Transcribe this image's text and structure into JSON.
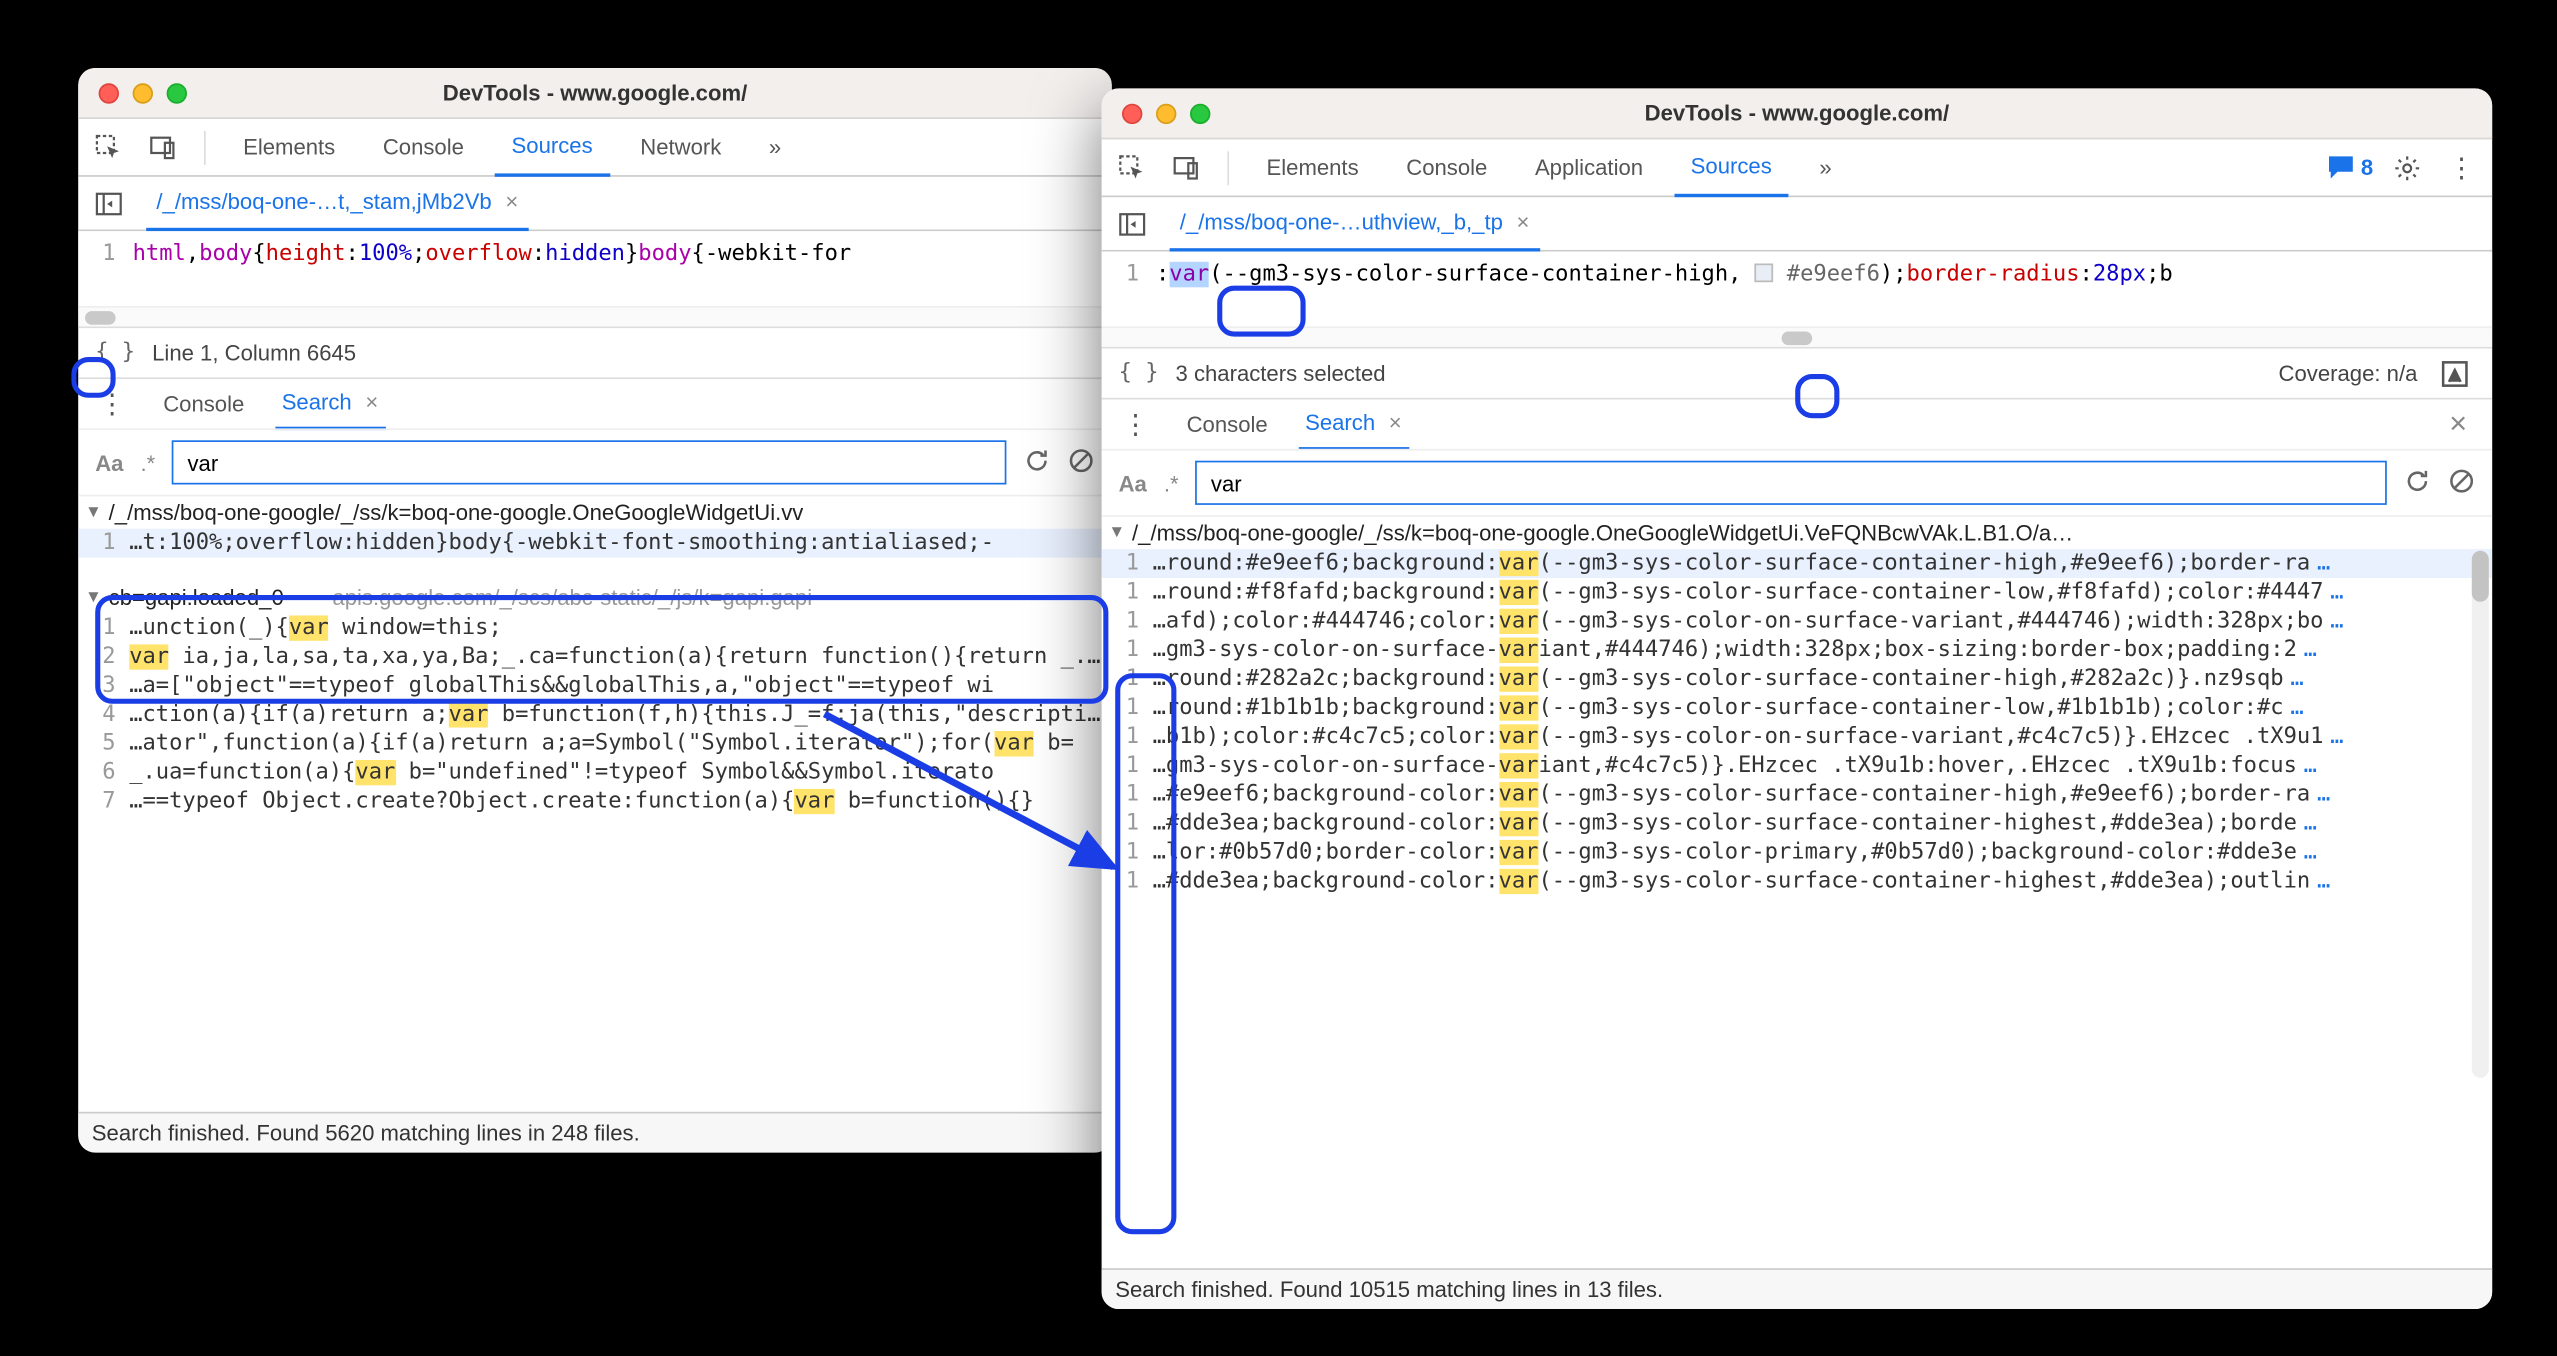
{
  "left": {
    "title": "DevTools - www.google.com/",
    "tabs": {
      "elements": "Elements",
      "console": "Console",
      "sources": "Sources",
      "network": "Network",
      "more": "»"
    },
    "fileTab": "/_/mss/boq-one-…t,_stam,jMb2Vb",
    "code": {
      "ln": "1",
      "seg1": "html",
      "seg2": ",",
      "seg3": "body",
      "seg4": "{",
      "seg5": "height",
      "seg6": ":",
      "seg7": "100%",
      "seg8": ";",
      "seg9": "overflow",
      "seg10": ":",
      "seg11": "hidden",
      "seg12": "}",
      "seg13": "body",
      "seg14": "{-webkit-for"
    },
    "status": "Line 1, Column 6645",
    "drawer": {
      "console": "Console",
      "search": "Search"
    },
    "search": {
      "Aa": "Aa",
      "regex": ".*",
      "value": "var"
    },
    "results": {
      "file1Tri": "▼",
      "file1Path": "/_/mss/boq-one-google/_/ss/k=boq-one-google.OneGoogleWidgetUi.vv",
      "r1": {
        "ln": "1",
        "pre": "…t:100%;overflow:hidden}body{-webkit-font-smoothing:antialiased;-"
      },
      "file2Tri": "▼",
      "file2Name": "cb=gapi.loaded_0",
      "file2Dash": "—",
      "file2Origin": "apis.google.com/_/scs/abc-static/_/js/k=gapi.gapi",
      "rows": [
        {
          "ln": "1",
          "pre": "…unction(_){",
          "hl": "var",
          "post": " window=this;"
        },
        {
          "ln": "2",
          "pre": "",
          "hl": "var",
          "post": " ia,ja,la,sa,ta,xa,ya,Ba;_.ca=function(a){return function(){return _.ba"
        },
        {
          "ln": "3",
          "pre": "…a=[\"object\"==typeof globalThis&&globalThis,a,\"object\"==typeof wi",
          "hl": "",
          "post": ""
        },
        {
          "ln": "4",
          "pre": "…ction(a){if(a)return a;",
          "hl": "var",
          "post": " b=function(f,h){this.J_=f;ja(this,\"description\""
        },
        {
          "ln": "5",
          "pre": "…ator\",function(a){if(a)return a;a=Symbol(\"Symbol.iterator\");for(",
          "hl": "var",
          "post": " b="
        },
        {
          "ln": "6",
          "pre": "_.ua=function(a){",
          "hl": "var",
          "post": " b=\"undefined\"!=typeof Symbol&&Symbol.iterato"
        },
        {
          "ln": "7",
          "pre": "…==typeof Object.create?Object.create:function(a){",
          "hl": "var",
          "post": " b=function(){}"
        }
      ]
    },
    "footer": "Search finished.  Found 5620 matching lines in 248 files."
  },
  "right": {
    "title": "DevTools - www.google.com/",
    "tabs": {
      "elements": "Elements",
      "console": "Console",
      "application": "Application",
      "sources": "Sources",
      "more": "»",
      "msgCount": "8"
    },
    "fileTab": "/_/mss/boq-one-…uthview,_b,_tp",
    "code": {
      "ln": "1",
      "colon": ":",
      "sel": "var",
      "seg1": "(--gm3-sys-color-surface-container-high, ",
      "seg2": "#e9eef6",
      "seg3": ");",
      "seg4": "border-radius",
      "seg5": ":",
      "seg6": "28px",
      "seg7": ";b"
    },
    "status": "3 characters selected",
    "coverage": "Coverage: n/a",
    "drawer": {
      "console": "Console",
      "search": "Search"
    },
    "search": {
      "Aa": "Aa",
      "regex": ".*",
      "value": "var"
    },
    "results": {
      "fileTri": "▼",
      "filePath": "/_/mss/boq-one-google/_/ss/k=boq-one-google.OneGoogleWidgetUi.VeFQNBcwVAk.L.B1.O/a…",
      "rows": [
        {
          "ln": "1",
          "pre": "…round:#e9eef6;background:",
          "hl": "var",
          "post": "(--gm3-sys-color-surface-container-high,#e9eef6);border-ra",
          "hover": true
        },
        {
          "ln": "1",
          "pre": "…round:#f8fafd;background:",
          "hl": "var",
          "post": "(--gm3-sys-color-surface-container-low,#f8fafd);color:#4447"
        },
        {
          "ln": "1",
          "pre": "…afd);color:#444746;color:",
          "hl": "var",
          "post": "(--gm3-sys-color-on-surface-variant,#444746);width:328px;bo"
        },
        {
          "ln": "1",
          "pre": "…gm3-sys-color-on-surface-",
          "hl": "var",
          "post": "iant,#444746);width:328px;box-sizing:border-box;padding:2"
        },
        {
          "ln": "1",
          "pre": "…round:#282a2c;background:",
          "hl": "var",
          "post": "(--gm3-sys-color-surface-container-high,#282a2c)}.nz9sqb"
        },
        {
          "ln": "1",
          "pre": "…round:#1b1b1b;background:",
          "hl": "var",
          "post": "(--gm3-sys-color-surface-container-low,#1b1b1b);color:#c"
        },
        {
          "ln": "1",
          "pre": "…b1b);color:#c4c7c5;color:",
          "hl": "var",
          "post": "(--gm3-sys-color-on-surface-variant,#c4c7c5)}.EHzcec .tX9u1"
        },
        {
          "ln": "1",
          "pre": "…gm3-sys-color-on-surface-",
          "hl": "var",
          "post": "iant,#c4c7c5)}.EHzcec .tX9u1b:hover,.EHzcec .tX9u1b:focus"
        },
        {
          "ln": "1",
          "pre": "…#e9eef6;background-color:",
          "hl": "var",
          "post": "(--gm3-sys-color-surface-container-high,#e9eef6);border-ra"
        },
        {
          "ln": "1",
          "pre": "…#dde3ea;background-color:",
          "hl": "var",
          "post": "(--gm3-sys-color-surface-container-highest,#dde3ea);borde"
        },
        {
          "ln": "1",
          "pre": "…lor:#0b57d0;border-color:",
          "hl": "var",
          "post": "(--gm3-sys-color-primary,#0b57d0);background-color:#dde3e"
        },
        {
          "ln": "1",
          "pre": "…#dde3ea;background-color:",
          "hl": "var",
          "post": "(--gm3-sys-color-surface-container-highest,#dde3ea);outlin"
        }
      ]
    },
    "footer": "Search finished.  Found 10515 matching lines in 13 files."
  },
  "icons": {
    "dots": "⋮",
    "chevrons": "»",
    "x": "×",
    "tri": "▼"
  }
}
